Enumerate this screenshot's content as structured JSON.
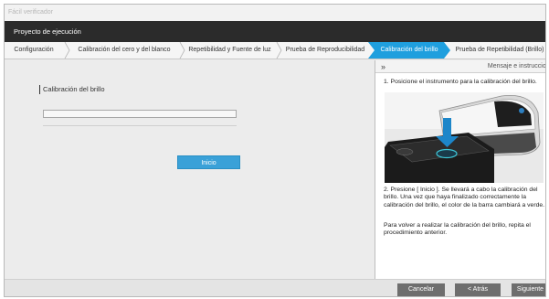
{
  "window": {
    "title": "Fácil verificador"
  },
  "project": {
    "title": "Proyecto de ejecución"
  },
  "steps": [
    {
      "label": "Configuración"
    },
    {
      "label": "Calibración del cero y del blanco"
    },
    {
      "label": "Repetibilidad y Fuente de luz"
    },
    {
      "label": "Prueba de Reproducibilidad"
    },
    {
      "label": "Calibración del brillo",
      "active": true
    },
    {
      "label": "Prueba de Repetibilidad (Brillo)"
    }
  ],
  "main": {
    "section_label": "Calibración del brillo",
    "progress": 0,
    "start_label": "Inicio"
  },
  "panel": {
    "collapse_glyph": "»",
    "title": "Mensaje e instrucciones",
    "step1": "1. Posicione el instrumento para la calibración del brillo.",
    "step2": "2. Presione [ Inicio ]. Se llevará a cabo la calibración del brillo. Una vez que haya finalizado correctamente la calibración del brillo, el color de la barra cambiará a verde.",
    "step3": "Para volver a realizar la calibración del brillo, repita el procedimiento anterior."
  },
  "footer": {
    "cancel_label": "Cancelar",
    "back_label": "< Atrás",
    "next_label": "Siguiente >"
  },
  "colors": {
    "accent": "#1f9fde",
    "title_bar": "#2b2b2b",
    "footer_button": "#6e6e6e",
    "progress_complete": "#4caf50"
  },
  "icons": {
    "collapse": "double-chevron-right-icon"
  }
}
